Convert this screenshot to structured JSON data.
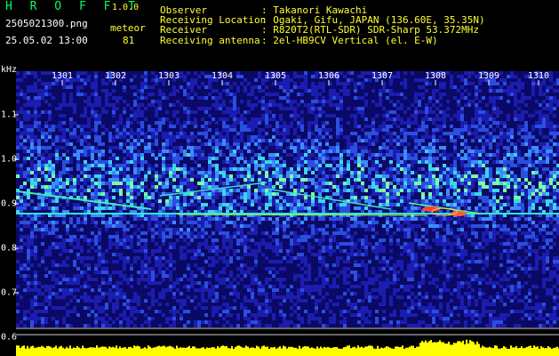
{
  "app": {
    "title": "H R O F F T",
    "version": "1.0.0"
  },
  "file": {
    "name": "2505021300.png",
    "datetime": "25.05.02 13:00"
  },
  "meteor": {
    "label": "meteor",
    "count": "81"
  },
  "metadata": [
    {
      "label": "Observer",
      "value": ": Takanori Kawachi"
    },
    {
      "label": "Receiving Location",
      "value": ": Ogaki, Gifu, JAPAN (136.60E, 35.35N)"
    },
    {
      "label": "Receiver",
      "value": ": R820T2(RTL-SDR) SDR-Sharp 53.372MHz"
    },
    {
      "label": "Receiving antenna",
      "value": ": 2el-HB9CV Vertical (el. E-W)"
    }
  ],
  "axis": {
    "freq_unit": "kHz",
    "time_ticks": [
      "1301",
      "1302",
      "1303",
      "1304",
      "1305",
      "1306",
      "1307",
      "1308",
      "1309",
      "1310"
    ],
    "freq_ticks": [
      "1.1",
      "1.0",
      "0.9",
      "0.8",
      "0.7",
      "0.6"
    ]
  },
  "colors": {
    "background": "#000000",
    "header_green": "#00ff66",
    "header_yellow": "#ffff33",
    "label_white": "#ffffff",
    "level_bar": "#ffff00"
  }
}
